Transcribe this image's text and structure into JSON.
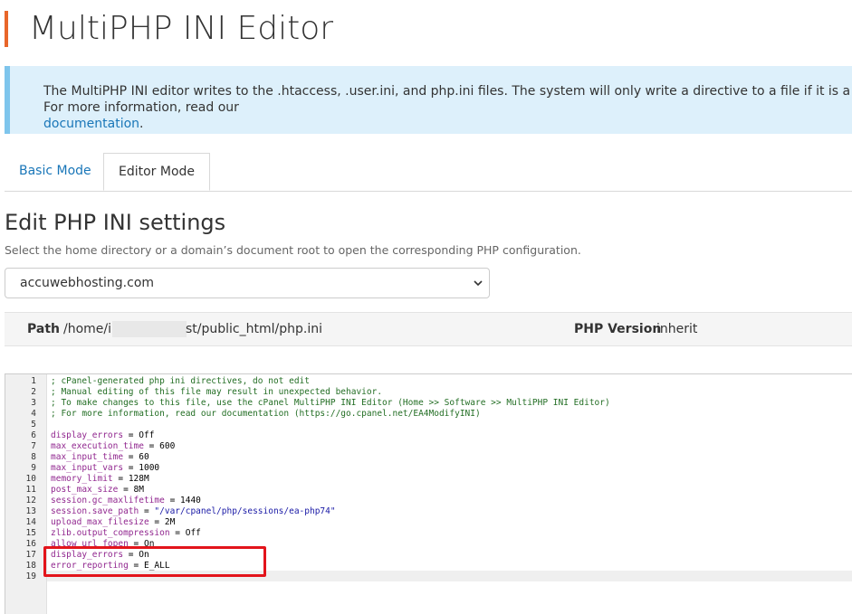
{
  "page": {
    "title": "MultiPHP INI Editor"
  },
  "info": {
    "text": "The MultiPHP INI editor writes to the .htaccess, .user.ini, and php.ini files. The system will only write a directive to a file if it is a valid directive for that file. For more information, read our ",
    "link": "documentation",
    "suffix": "."
  },
  "tabs": [
    {
      "label": "Basic Mode",
      "active": false
    },
    {
      "label": "Editor Mode",
      "active": true
    }
  ],
  "section": {
    "heading": "Edit PHP INI settings",
    "description": "Select the home directory or a domain’s document root to open the corresponding PHP configuration."
  },
  "domain_select": {
    "value": "accuwebhosting.com"
  },
  "path_bar": {
    "path_label": "Path",
    "path_prefix": "/home/i",
    "path_suffix": "st/public_html/php.ini",
    "php_label": "PHP Version",
    "php_value": "inherit"
  },
  "editor": {
    "lines": [
      {
        "n": "1",
        "type": "comment",
        "text": "; cPanel-generated php ini directives, do not edit"
      },
      {
        "n": "2",
        "type": "comment",
        "text": "; Manual editing of this file may result in unexpected behavior."
      },
      {
        "n": "3",
        "type": "comment",
        "text": "; To make changes to this file, use the cPanel MultiPHP INI Editor (Home >> Software >> MultiPHP INI Editor)"
      },
      {
        "n": "4",
        "type": "comment",
        "text": "; For more information, read our documentation (https://go.cpanel.net/EA4ModifyINI)"
      },
      {
        "n": "5",
        "type": "blank",
        "text": ""
      },
      {
        "n": "6",
        "type": "kv",
        "key": "display_errors",
        "op": " = ",
        "val": "Off"
      },
      {
        "n": "7",
        "type": "kv",
        "key": "max_execution_time",
        "op": " = ",
        "val": "600"
      },
      {
        "n": "8",
        "type": "kv",
        "key": "max_input_time",
        "op": " = ",
        "val": "60"
      },
      {
        "n": "9",
        "type": "kv",
        "key": "max_input_vars",
        "op": " = ",
        "val": "1000"
      },
      {
        "n": "10",
        "type": "kv",
        "key": "memory_limit",
        "op": " = ",
        "val": "128M"
      },
      {
        "n": "11",
        "type": "kv",
        "key": "post_max_size",
        "op": " = ",
        "val": "8M"
      },
      {
        "n": "12",
        "type": "kv",
        "key": "session.gc_maxlifetime",
        "op": " = ",
        "val": "1440"
      },
      {
        "n": "13",
        "type": "kvs",
        "key": "session.save_path",
        "op": " = ",
        "val": "\"/var/cpanel/php/sessions/ea-php74\""
      },
      {
        "n": "14",
        "type": "kv",
        "key": "upload_max_filesize",
        "op": " = ",
        "val": "2M"
      },
      {
        "n": "15",
        "type": "kv",
        "key": "zlib.output_compression",
        "op": " = ",
        "val": "Off"
      },
      {
        "n": "16",
        "type": "kv",
        "key": "allow_url_fopen",
        "op": " = ",
        "val": "On"
      },
      {
        "n": "17",
        "type": "kv",
        "key": "display_errors",
        "op": " = ",
        "val": "On"
      },
      {
        "n": "18",
        "type": "kv",
        "key": "error_reporting",
        "op": " = ",
        "val": "E_ALL"
      },
      {
        "n": "19",
        "type": "blank",
        "text": ""
      }
    ]
  },
  "colors": {
    "accent": "#e8662a",
    "info_bg": "#ddf0fb",
    "link": "#1976b8",
    "highlight": "#e3141b"
  }
}
